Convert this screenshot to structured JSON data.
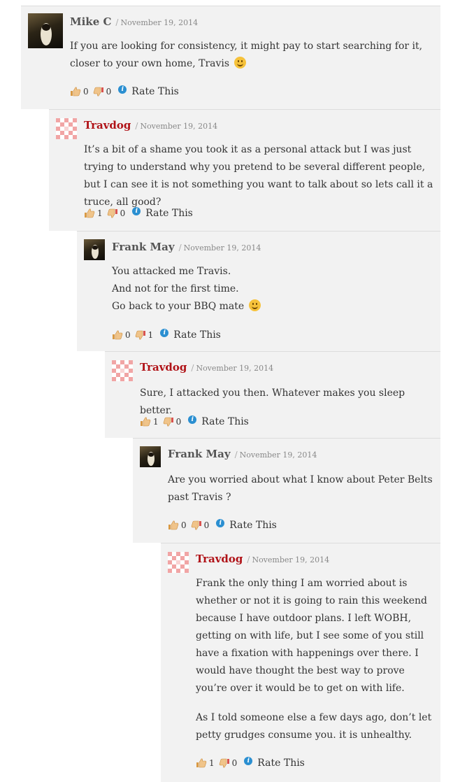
{
  "comments": [
    {
      "author": "Mike C",
      "separator": "/",
      "date": "November 19, 2014",
      "paragraphs": [
        "If you are looking for consistency, it might pay to start searching for it, closer to your own home, Travis"
      ],
      "likes": "0",
      "dislikes": "0",
      "rate_label": "Rate This"
    },
    {
      "author": "Travdog",
      "separator": "/",
      "date": "November 19, 2014",
      "paragraphs": [
        "It’s a bit of a shame you took it as a personal attack but I was just trying to understand why you pretend to be several different people, but I can see it is not something you want to talk about so lets call it a truce, all good?"
      ],
      "likes": "1",
      "dislikes": "0",
      "rate_label": "Rate This"
    },
    {
      "author": "Frank May",
      "separator": "/",
      "date": "November 19, 2014",
      "lines": [
        "You attacked me Travis.",
        "And not for the first time.",
        "Go back to your BBQ mate"
      ],
      "likes": "0",
      "dislikes": "1",
      "rate_label": "Rate This"
    },
    {
      "author": "Travdog",
      "separator": "/",
      "date": "November 19, 2014",
      "paragraphs": [
        "Sure, I attacked you then. Whatever makes you sleep better."
      ],
      "likes": "1",
      "dislikes": "0",
      "rate_label": "Rate This"
    },
    {
      "author": "Frank May",
      "separator": "/",
      "date": "November 19, 2014",
      "paragraphs": [
        "Are you worried about what I know about Peter Belts past Travis ?"
      ],
      "likes": "0",
      "dislikes": "0",
      "rate_label": "Rate This"
    },
    {
      "author": "Travdog",
      "separator": "/",
      "date": "November 19, 2014",
      "paragraphs": [
        "Frank the only thing I am worried about is whether or not it is going to rain this weekend because I have outdoor plans. I left WOBH, getting on with life, but I see some of you still have a fixation with happenings over there. I would have thought the best way to prove you’re over it would be to get on with life.",
        "As I told someone else a few days ago, don’t let petty grudges consume you. it is unhealthy."
      ],
      "likes": "1",
      "dislikes": "0",
      "rate_label": "Rate This"
    }
  ],
  "colors": {
    "author_link": "#b01217",
    "author_plain": "#555555",
    "panel_bg": "#f2f2f2",
    "info_icon": "#2b8fd1"
  },
  "icons": {
    "like": "thumbs-up-icon",
    "dislike": "thumbs-down-icon",
    "info": "info-icon",
    "emoji": "smiley-emoji-icon"
  }
}
